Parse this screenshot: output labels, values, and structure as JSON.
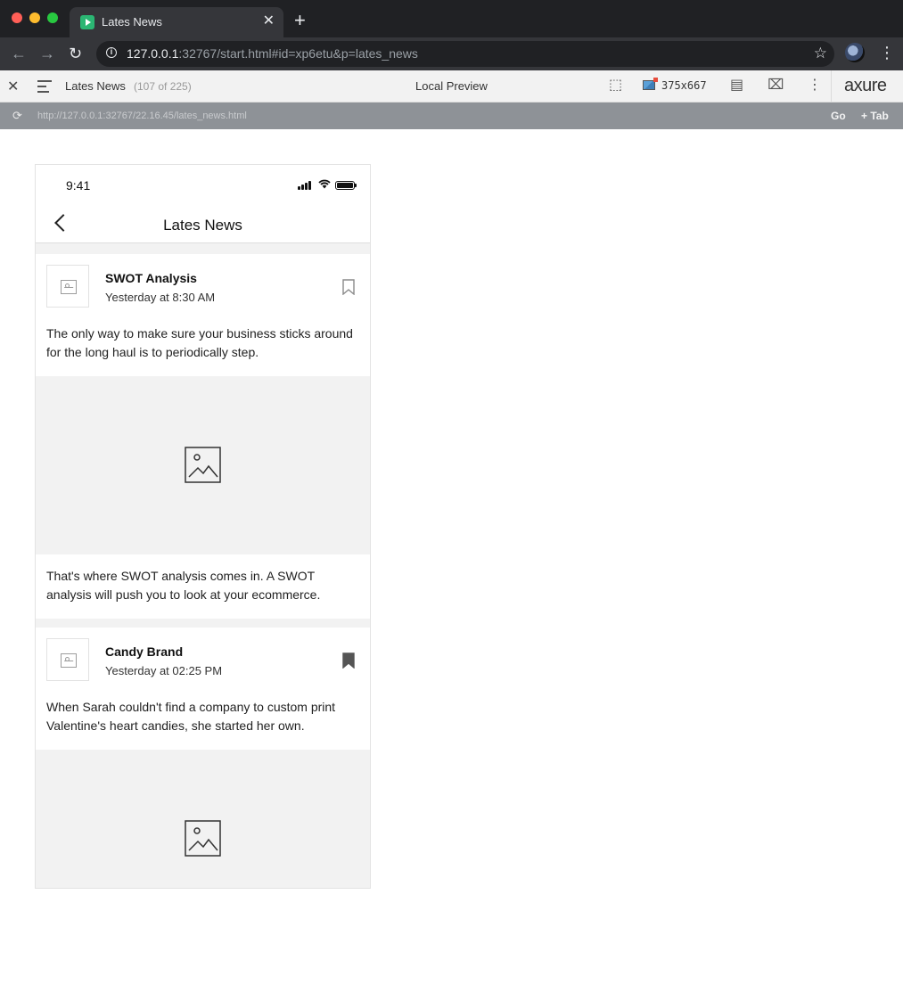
{
  "browser": {
    "tab_title": "Lates News",
    "url_host": "127.0.0.1",
    "url_rest": ":32767/start.html#id=xp6etu&p=lates_news"
  },
  "axure": {
    "page_name": "Lates News",
    "page_count": "(107 of 225)",
    "mode": "Local Preview",
    "device_size": "375x667",
    "logo": "axure",
    "preview_url": "http://127.0.0.1:32767/22.16.45/lates_news.html",
    "go_label": "Go",
    "tab_label": "+ Tab"
  },
  "phone": {
    "status_time": "9:41",
    "nav_title": "Lates News",
    "posts": [
      {
        "title": "SWOT Analysis",
        "time": "Yesterday at 8:30 AM",
        "text": "The only way to make sure your business sticks around for the long haul is to periodically step.",
        "caption": "That's where SWOT analysis comes in. A SWOT analysis will push you to look at your ecommerce.",
        "bookmarked": false
      },
      {
        "title": "Candy Brand",
        "time": "Yesterday at 02:25 PM",
        "text": "When Sarah couldn't find a company to custom print Valentine's heart candies, she started her own.",
        "bookmarked": true
      }
    ]
  },
  "colors": {
    "chrome_dark": "#202124",
    "chrome_tab": "#35363a",
    "axure_bar": "#f2f2f2",
    "preview_strip": "#8e9297",
    "placeholder_bg": "#f2f2f2"
  },
  "icons": [
    "favicon-play-icon",
    "close-icon",
    "plus-icon",
    "back-arrow-icon",
    "forward-arrow-icon",
    "reload-icon",
    "info-icon",
    "star-icon",
    "profile-avatar",
    "kebab-menu-icon",
    "hamburger-icon",
    "inspect-cursor-icon",
    "device-size-icon",
    "notes-icon",
    "variables-icon",
    "refresh-icon",
    "signal-icon",
    "wifi-icon",
    "battery-icon",
    "chevron-left-icon",
    "image-placeholder-icon",
    "bookmark-outline-icon",
    "bookmark-filled-icon"
  ]
}
